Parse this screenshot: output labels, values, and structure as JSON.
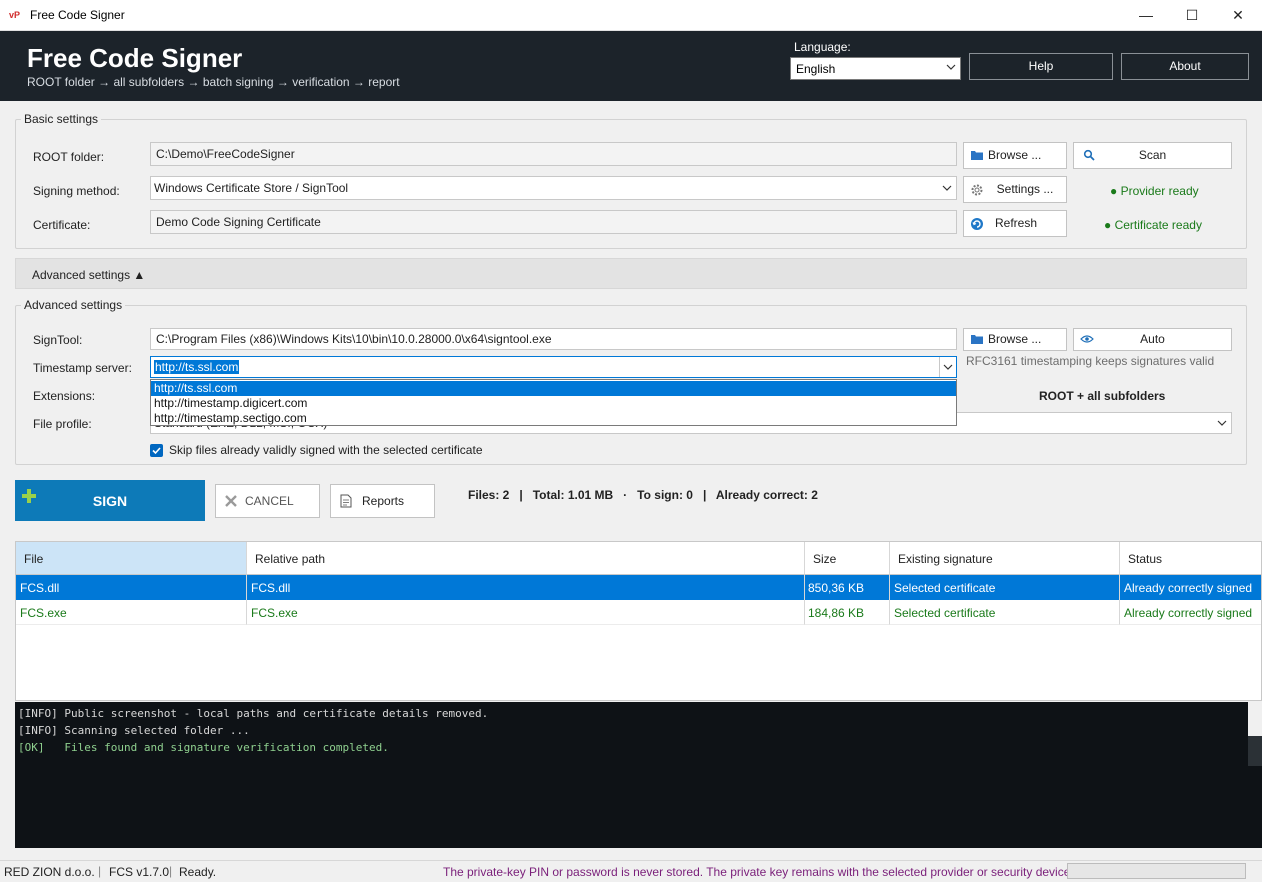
{
  "window": {
    "title": "Free Code Signer",
    "app_icon": "vP",
    "minimize": "—",
    "maximize": "☐",
    "close": "✕"
  },
  "header": {
    "title": "Free Code Signer",
    "subtitle": "ROOT folder → all subfolders → batch signing → verification → report",
    "language_label": "Language:",
    "language_value": "English",
    "help_label": "Help",
    "about_label": "About"
  },
  "basic": {
    "title": "Basic settings",
    "root_label": "ROOT folder:",
    "root_value": "C:\\Demo\\FreeCodeSigner",
    "browse_label": "Browse ...",
    "scan_label": "Scan",
    "method_label": "Signing method:",
    "method_value": "Windows Certificate Store / SignTool",
    "settings_label": "Settings ...",
    "provider_status": "● Provider ready",
    "cert_label": "Certificate:",
    "cert_value": "Demo Code Signing Certificate",
    "refresh_label": "Refresh",
    "cert_status": "● Certificate ready"
  },
  "advanced_toggle": "Advanced settings ▲",
  "advanced": {
    "title": "Advanced settings",
    "signtool_label": "SignTool:",
    "signtool_value": "C:\\Program Files (x86)\\Windows Kits\\10\\bin\\10.0.28000.0\\x64\\signtool.exe",
    "browse_label": "Browse ...",
    "auto_label": "Auto",
    "timestamp_label": "Timestamp server:",
    "timestamp_value": "http://ts.ssl.com",
    "timestamp_hint": "RFC3161 timestamping keeps signatures valid",
    "timestamp_options": [
      "http://ts.ssl.com",
      "http://timestamp.digicert.com",
      "http://timestamp.sectigo.com"
    ],
    "extensions_label": "Extensions:",
    "scope_label": "ROOT + all subfolders",
    "profile_label": "File profile:",
    "profile_value": "Standard (EXE, DLL, MSI, OCX)",
    "skip_label": "Skip files already validly signed with the selected certificate"
  },
  "actions": {
    "sign_label": "SIGN",
    "cancel_label": "CANCEL",
    "reports_label": "Reports",
    "stats": "Files: 2   |   Total: 1.01 MB   ·   To sign: 0   |   Already correct: 2"
  },
  "table": {
    "columns": [
      "File",
      "Relative path",
      "Size",
      "Existing signature",
      "Status"
    ],
    "rows": [
      {
        "file": "FCS.dll",
        "path": "FCS.dll",
        "size": "850,36 KB",
        "signature": "Selected certificate",
        "status": "Already correctly signed"
      },
      {
        "file": "FCS.exe",
        "path": "FCS.exe",
        "size": "184,86 KB",
        "signature": "Selected certificate",
        "status": "Already correctly signed"
      }
    ]
  },
  "log": [
    "[INFO] Public screenshot - local paths and certificate details removed.",
    "[INFO] Scanning selected folder ...",
    "[OK]   Files found and signature verification completed."
  ],
  "status": {
    "company": "RED ZION d.o.o.",
    "version": "FCS v1.7.0",
    "state": "Ready.",
    "notice": "The private-key PIN or password is never stored. The private key remains with the selected provider or security device."
  },
  "colors": {
    "header_bg": "#1c232a",
    "accent": "#0d7ab8",
    "selection": "#0078d7",
    "ready_green": "#1a7a1a",
    "notice_purple": "#7a1f7a"
  }
}
